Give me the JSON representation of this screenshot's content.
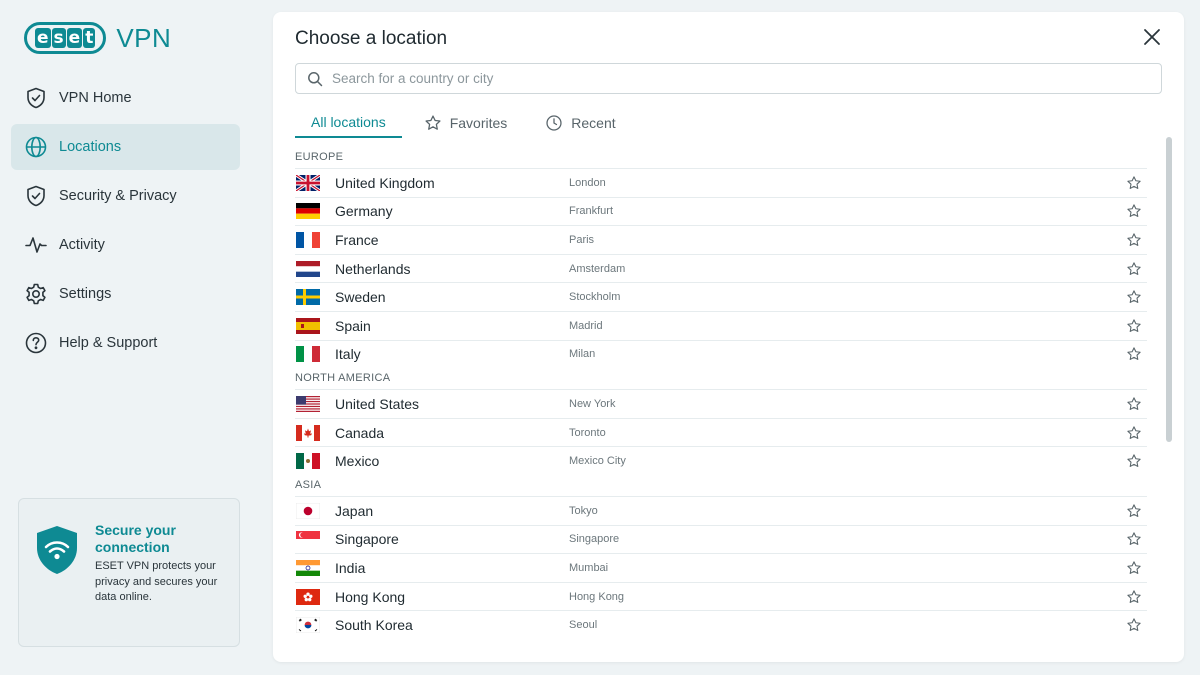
{
  "brand": {
    "logo_letters": [
      "e",
      "s",
      "e",
      "t"
    ],
    "product": "VPN",
    "accent": "#0e8a93"
  },
  "sidebar": {
    "items": [
      {
        "id": "vpn-home",
        "label": "VPN Home",
        "icon": "shield-check-icon",
        "active": false
      },
      {
        "id": "locations",
        "label": "Locations",
        "icon": "globe-icon",
        "active": true
      },
      {
        "id": "security-privacy",
        "label": "Security & Privacy",
        "icon": "shield-check-icon",
        "active": false
      },
      {
        "id": "activity",
        "label": "Activity",
        "icon": "pulse-icon",
        "active": false
      },
      {
        "id": "settings",
        "label": "Settings",
        "icon": "gear-icon",
        "active": false
      },
      {
        "id": "help-support",
        "label": "Help & Support",
        "icon": "question-circle-icon",
        "active": false
      }
    ],
    "promo": {
      "title": "Secure your connection",
      "body": "ESET VPN protects your privacy and secures your data online."
    }
  },
  "panel": {
    "title": "Choose a location",
    "search_placeholder": "Search for a country or city",
    "tabs": [
      {
        "id": "all",
        "label": "All locations",
        "active": true
      },
      {
        "id": "favorites",
        "label": "Favorites",
        "icon": "star-icon",
        "active": false
      },
      {
        "id": "recent",
        "label": "Recent",
        "icon": "clock-icon",
        "active": false
      }
    ],
    "groups": [
      {
        "label": "EUROPE",
        "rows": [
          {
            "country": "United Kingdom",
            "city": "London",
            "flag": "uk"
          },
          {
            "country": "Germany",
            "city": "Frankfurt",
            "flag": "de"
          },
          {
            "country": "France",
            "city": "Paris",
            "flag": "fr"
          },
          {
            "country": "Netherlands",
            "city": "Amsterdam",
            "flag": "nl"
          },
          {
            "country": "Sweden",
            "city": "Stockholm",
            "flag": "se"
          },
          {
            "country": "Spain",
            "city": "Madrid",
            "flag": "es"
          },
          {
            "country": "Italy",
            "city": "Milan",
            "flag": "it"
          }
        ]
      },
      {
        "label": "NORTH AMERICA",
        "rows": [
          {
            "country": "United States",
            "city": "New York",
            "flag": "us"
          },
          {
            "country": "Canada",
            "city": "Toronto",
            "flag": "ca"
          },
          {
            "country": "Mexico",
            "city": "Mexico City",
            "flag": "mx"
          }
        ]
      },
      {
        "label": "ASIA",
        "rows": [
          {
            "country": "Japan",
            "city": "Tokyo",
            "flag": "jp"
          },
          {
            "country": "Singapore",
            "city": "Singapore",
            "flag": "sg"
          },
          {
            "country": "India",
            "city": "Mumbai",
            "flag": "in"
          },
          {
            "country": "Hong Kong",
            "city": "Hong Kong",
            "flag": "hk"
          },
          {
            "country": "South Korea",
            "city": "Seoul",
            "flag": "kr"
          }
        ]
      }
    ]
  }
}
